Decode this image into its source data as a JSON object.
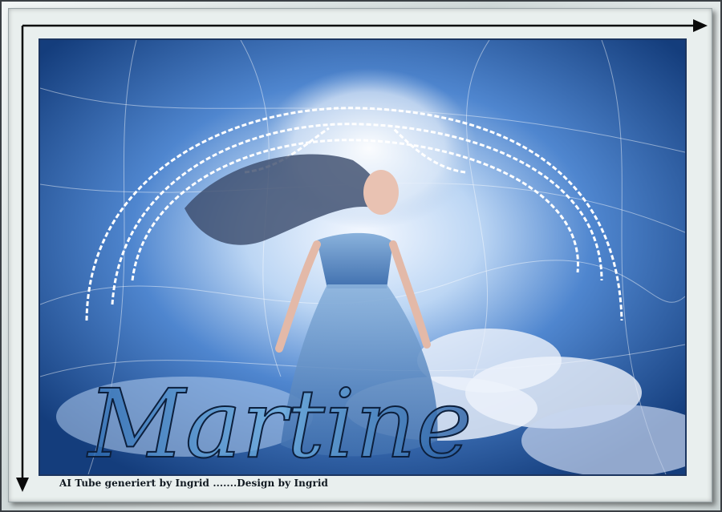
{
  "artwork": {
    "signature": "Martine",
    "credit": "AI Tube generiert by Ingrid .......Design by Ingrid"
  },
  "colors": {
    "deep_blue": "#15407f",
    "mid_blue": "#2d6ec0",
    "light_blue": "#9cc6f0",
    "glow": "#eef5ff",
    "frame_grey": "#d4dcdc",
    "arrow": "#0a0a0a"
  },
  "icons": [
    "arrow-right-icon",
    "arrow-down-icon"
  ]
}
